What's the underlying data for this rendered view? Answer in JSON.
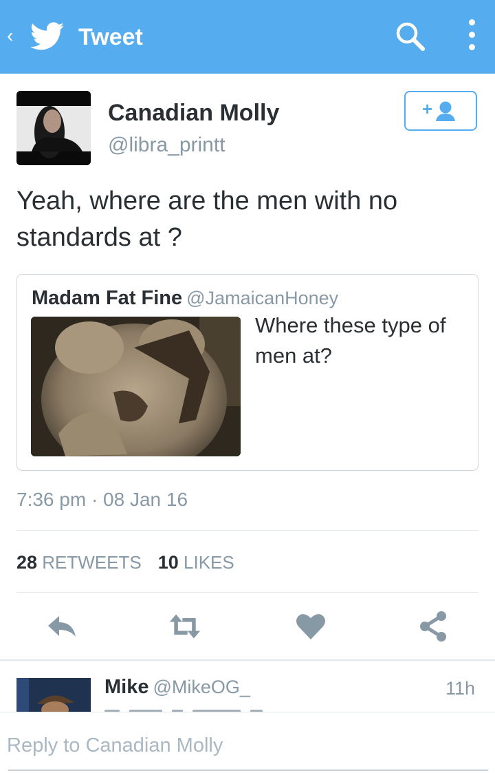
{
  "header": {
    "title": "Tweet",
    "back_icon": "chevron-left-icon",
    "logo_icon": "twitter-bird-icon",
    "search_icon": "search-icon",
    "more_icon": "overflow-menu-icon",
    "color": "#55acee"
  },
  "tweet": {
    "author_name": "Canadian Molly",
    "author_handle": "@libra_printt",
    "text": "Yeah, where are the men with no standards at ?",
    "timestamp": "7:36 pm · 08 Jan 16",
    "follow_icon": "add-user-icon",
    "stats": {
      "retweets_count": "28",
      "retweets_label": "RETWEETS",
      "likes_count": "10",
      "likes_label": "LIKES"
    }
  },
  "quoted_tweet": {
    "author_name": "Madam Fat Fine",
    "author_handle": "@JamaicanHoney",
    "text": "Where these type of men at?"
  },
  "actions": [
    {
      "name": "reply",
      "icon": "reply-icon"
    },
    {
      "name": "retweet",
      "icon": "retweet-icon"
    },
    {
      "name": "like",
      "icon": "heart-icon"
    },
    {
      "name": "share",
      "icon": "share-icon"
    }
  ],
  "reply_preview": {
    "author_name": "Mike",
    "author_handle": "@MikeOG_",
    "time": "11h"
  },
  "reply_box": {
    "placeholder": "Reply to Canadian Molly"
  },
  "colors": {
    "accent": "#55acee",
    "icon_gray": "#8899a6",
    "text": "#292f33",
    "divider": "#e1e8ed"
  }
}
